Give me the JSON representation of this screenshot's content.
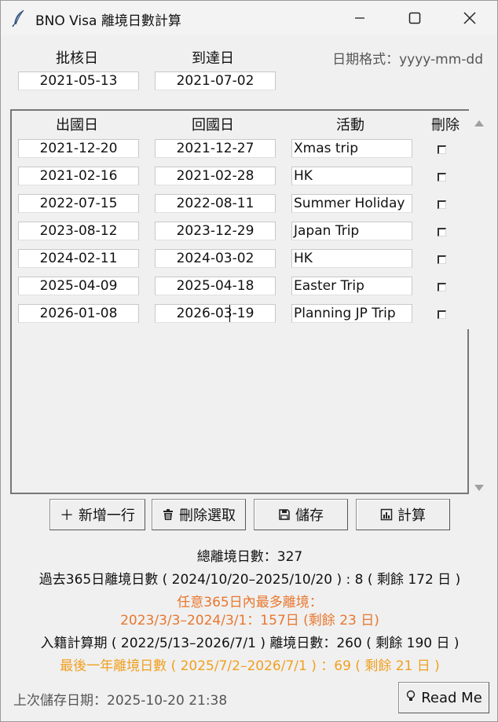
{
  "window": {
    "title": "BNO Visa 離境日數計算",
    "icons": {
      "app": "feather-icon",
      "minimize": "minimize-icon",
      "maximize": "maximize-icon",
      "close": "close-icon"
    }
  },
  "header": {
    "approval_label": "批核日",
    "arrival_label": "到達日",
    "format_hint": "日期格式：yyyy-mm-dd",
    "approval_date": "2021-05-13",
    "arrival_date": "2021-07-02"
  },
  "table": {
    "columns": [
      "出國日",
      "回國日",
      "活動",
      "刪除"
    ],
    "rows": [
      {
        "out": "2021-12-20",
        "back": "2021-12-27",
        "activity": "Xmas trip",
        "delete": false
      },
      {
        "out": "2021-02-16",
        "back": "2021-02-28",
        "activity": "HK",
        "delete": false
      },
      {
        "out": "2022-07-15",
        "back": "2022-08-11",
        "activity": "Summer Holiday",
        "delete": false
      },
      {
        "out": "2023-08-12",
        "back": "2023-12-29",
        "activity": "Japan Trip",
        "delete": false
      },
      {
        "out": "2024-02-11",
        "back": "2024-03-02",
        "activity": "HK",
        "delete": false
      },
      {
        "out": "2025-04-09",
        "back": "2025-04-18",
        "activity": "Easter Trip",
        "delete": false
      },
      {
        "out": "2026-01-08",
        "back": "2026-03-19",
        "activity": "Planning JP Trip",
        "delete": false
      }
    ]
  },
  "toolbar": {
    "add_label": "＋ 新增一行",
    "delete_label": "刪除選取",
    "save_label": "儲存",
    "calc_label": "計算"
  },
  "summary": {
    "total": "總離境日數：327",
    "past365": "過去365日離境日數 ( 2024/10/20–2025/10/20 ) : 8 ( 剩餘 172 日 )",
    "max_any_365_title": "任意365日內最多離境：",
    "max_any_365_detail": "2023/3/3–2024/3/1：157日 (剩餘 23 日)",
    "naturalisation": "入籍計算期 ( 2022/5/13–2026/7/1 ) 離境日數：260 ( 剩餘 190 日 )",
    "last_year": "最後一年離境日數 ( 2025/7/2–2026/7/1 ) ：69 ( 剩餘 21 日 )"
  },
  "footer": {
    "last_saved": "上次儲存日期：2025-10-20 21:38",
    "readme_label": "Read Me"
  },
  "colors": {
    "warn_orange": "#e8772e",
    "amber": "#f0a020"
  }
}
